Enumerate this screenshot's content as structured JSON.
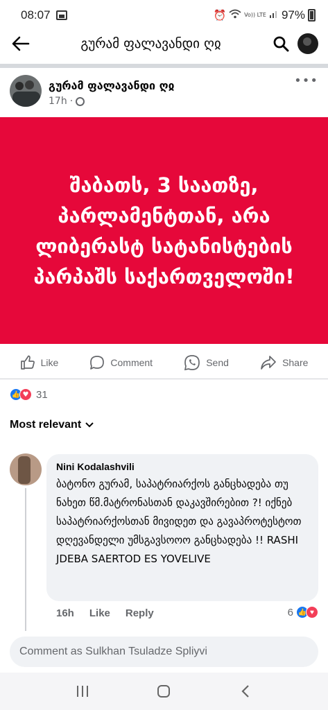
{
  "status_bar": {
    "time": "08:07",
    "lte": "Vo)) LTE",
    "battery": "97%"
  },
  "header": {
    "title": "გურამ ფალავანდი ღჲ",
    "back_icon": "arrow-left-icon",
    "search_icon": "search-icon"
  },
  "post": {
    "author": "გურამ ფალავანდი ღჲ",
    "time": "17h",
    "more": "•••",
    "banner_color": "#e6083a",
    "banner_text": "შაბათს, 3 საათზე, პარლამენტთან, არა ლიბერასტ სატანისტების პარპაშს საქართველოში!",
    "actions": {
      "like": "Like",
      "comment": "Comment",
      "send": "Send",
      "share": "Share"
    },
    "reaction_count": "31"
  },
  "comments": {
    "sort_label": "Most relevant",
    "items": [
      {
        "name": "Nini Kodalashvili",
        "text": "ბატონო გურამ, საპატრიარქოს განცხადება თუ ნახეთ წმ.მატრონასთან დაკავშირებით ?! იქნებ საპატრიარქოსთან მივიდეთ და გავაპროტესტოთ დღევანდელი უმსგავსოოო განცხადება !! RASHI JDEBA SAERTOD ES YOVELIVE",
        "time": "16h",
        "like": "Like",
        "reply": "Reply",
        "reaction_count": "6"
      }
    ]
  },
  "composer": {
    "placeholder": "Comment as Sulkhan Tsuladze Spliyvi"
  },
  "nav": {
    "recents": "|||",
    "home": "○",
    "back": "‹"
  }
}
